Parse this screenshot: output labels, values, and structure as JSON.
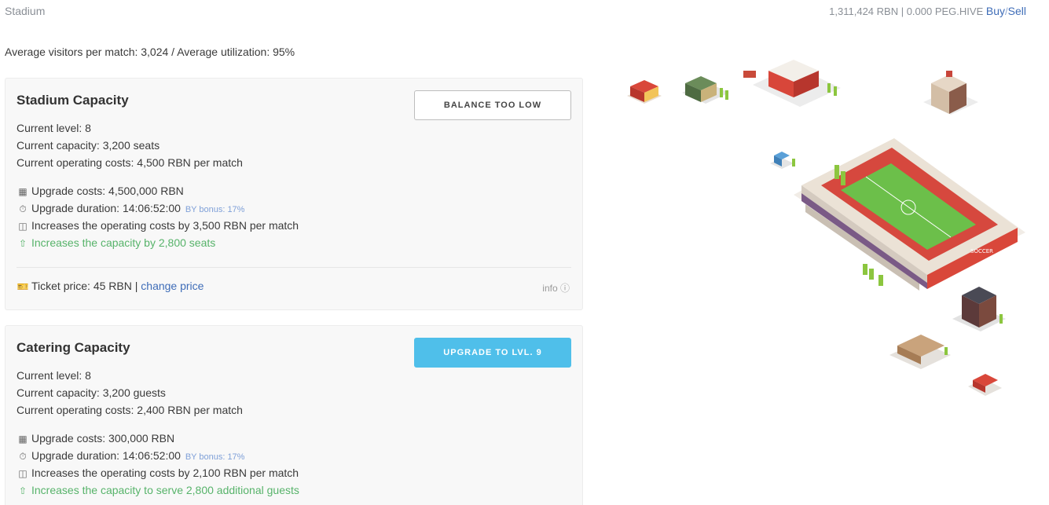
{
  "header": {
    "title": "Stadium",
    "balance_text": "1,311,424 RBN | 0.000 PEG.HIVE",
    "buy_label": "Buy",
    "separator": "/",
    "sell_label": "Sell"
  },
  "summary": "Average visitors per match: 3,024 / Average utilization: 95%",
  "cards": [
    {
      "title": "Stadium Capacity",
      "button_label": "BALANCE TOO LOW",
      "current_level": "Current level: 8",
      "current_capacity": "Current capacity: 3,200 seats",
      "current_costs": "Current operating costs: 4,500 RBN per match",
      "upgrade_costs": "Upgrade costs: 4,500,000 RBN",
      "upgrade_duration": "Upgrade duration: 14:06:52:00",
      "bonus": "BY bonus: 17%",
      "op_increase": "Increases the operating costs by 3,500 RBN per match",
      "capacity_increase": "Increases the capacity by 2,800 seats",
      "ticket_text": "Ticket price: 45 RBN |",
      "change_price": "change price",
      "info": "info"
    },
    {
      "title": "Catering Capacity",
      "button_label": "UPGRADE TO LVL. 9",
      "current_level": "Current level: 8",
      "current_capacity": "Current capacity: 3,200 guests",
      "current_costs": "Current operating costs: 2,400 RBN per match",
      "upgrade_costs": "Upgrade costs: 300,000 RBN",
      "upgrade_duration": "Upgrade duration: 14:06:52:00",
      "bonus": "BY bonus: 17%",
      "op_increase": "Increases the operating costs by 2,100 RBN per match",
      "capacity_increase": "Increases the capacity to serve 2,800 additional guests"
    }
  ],
  "illustration": {
    "stadium_sign": "SOCCER"
  },
  "colors": {
    "accent": "#4fbfea",
    "link": "#3f6db8",
    "positive": "#57b36a"
  },
  "icons": [
    "calculator-icon",
    "stopwatch-icon",
    "coins-icon",
    "arrow-up-circle-icon",
    "ticket-icon",
    "info-icon"
  ]
}
